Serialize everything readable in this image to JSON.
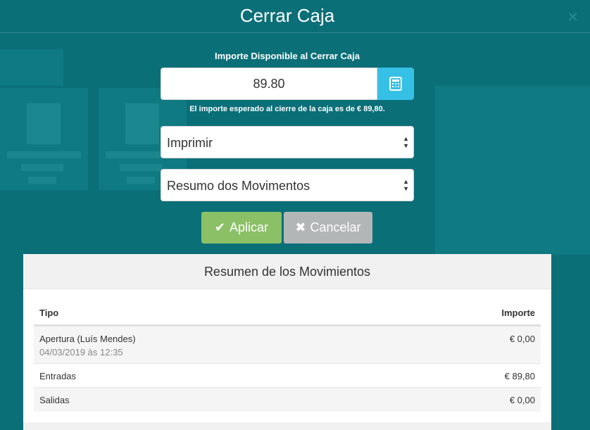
{
  "dialog": {
    "title": "Cerrar Caja",
    "close_icon": "close-icon"
  },
  "form": {
    "amount_label": "Importe Disponible al Cerrar Caja",
    "amount_value": "89.80",
    "calculator_icon": "calculator-icon",
    "expected_hint": "El importe esperado al cierre de la caja es de € 89,80.",
    "print_select": "Imprimir",
    "report_select": "Resumo dos Movimentos"
  },
  "buttons": {
    "apply_label": "Aplicar",
    "apply_icon": "check-icon",
    "cancel_label": "Cancelar",
    "cancel_icon": "times-icon"
  },
  "summary": {
    "title": "Resumen de los Movimientos",
    "columns": {
      "type": "Tipo",
      "amount": "Importe"
    },
    "rows": [
      {
        "type": "Apertura (Luís Mendes)",
        "date": "04/03/2019 às 12:35",
        "amount": "€ 0,00"
      },
      {
        "type": "Entradas",
        "amount": "€ 89,80"
      },
      {
        "type": "Salidas",
        "amount": "€ 0,00"
      }
    ]
  },
  "colors": {
    "background": "#0b6f78",
    "calculator_button": "#36c0e6",
    "apply_button": "#8cc067",
    "cancel_button": "#b3b6b7"
  }
}
